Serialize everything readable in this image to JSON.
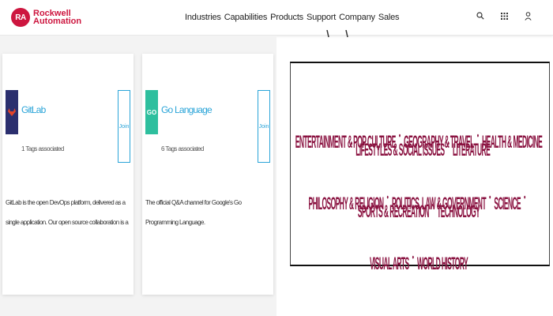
{
  "brand": {
    "line1": "Rockwell",
    "line2": "Automation",
    "mark": "RA",
    "color": "#cd163f"
  },
  "nav": [
    "Industries",
    "Capabilities",
    "Products",
    "Support",
    "Company",
    "Sales"
  ],
  "header_icons": [
    "search-icon",
    "grid-icon",
    "user-icon"
  ],
  "cards": [
    {
      "title": "GitLab",
      "tags": "1 Tags associated",
      "join": "Join",
      "description": "GitLab is the open DevOps platform, delivered as a single application. Our open source collaboration is a great place to sha..."
    },
    {
      "title": "Go Language",
      "icon_text": "GO",
      "tags": "6 Tags associated",
      "join": "Join",
      "description": "The official Q&A channel for Google's Go Programming Language."
    }
  ],
  "topics": {
    "row1": [
      "ENTERTAINMENT & POP CULTURE",
      "GEOGRAPHY & TRAVEL",
      "HEALTH & MEDICINE",
      "LIFESTYLES & SOCIAL ISSUES",
      "LITERATURE"
    ],
    "row2": [
      "PHILOSOPHY & RELIGION",
      "POLITICS, LAW & GOVERNMENT",
      "SCIENCE",
      "SPORTS & RECREATION",
      "TECHNOLOGY"
    ],
    "row3": [
      "VISUAL ARTS",
      "WORLD HISTORY"
    ]
  },
  "colors": {
    "link": "#2aa4d8",
    "topic": "#8a1240",
    "gitlab_bg": "#2b2f6e",
    "go_bg": "#2ebf9e"
  }
}
